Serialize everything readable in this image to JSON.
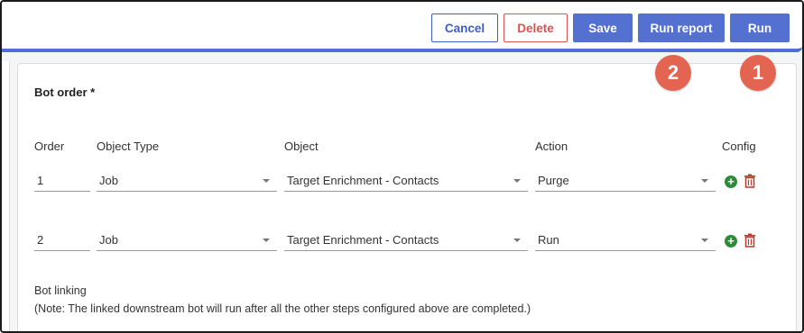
{
  "toolbar": {
    "cancel_label": "Cancel",
    "delete_label": "Delete",
    "save_label": "Save",
    "run_report_label": "Run report",
    "run_label": "Run"
  },
  "bot_order": {
    "title": "Bot order *",
    "columns": {
      "order": "Order",
      "object_type": "Object Type",
      "object": "Object",
      "action": "Action",
      "config": "Config"
    },
    "rows": [
      {
        "order": "1",
        "object_type": "Job",
        "object": "Target Enrichment - Contacts",
        "action": "Purge"
      },
      {
        "order": "2",
        "object_type": "Job",
        "object": "Target Enrichment - Contacts",
        "action": "Run"
      }
    ]
  },
  "bot_linking": {
    "title": "Bot linking",
    "note": "(Note: The linked downstream bot will run after all the other steps configured above are completed.)"
  },
  "annotations": {
    "badge_1": "1",
    "badge_2": "2"
  },
  "colors": {
    "primary": "#5470d0",
    "danger": "#d9534f",
    "add": "#2e8b3a",
    "badge": "#e36450"
  },
  "icons": {
    "add": "plus-circle-icon",
    "delete": "trash-icon",
    "dropdown": "chevron-down-icon"
  }
}
